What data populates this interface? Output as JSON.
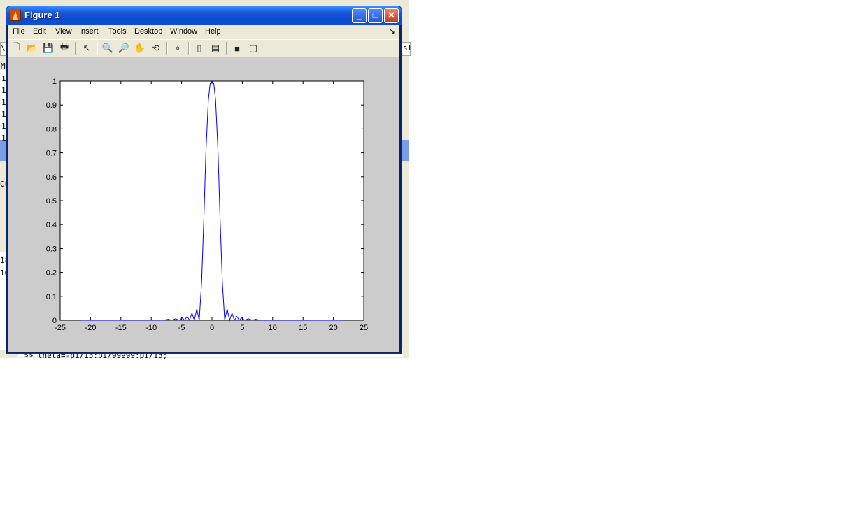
{
  "window": {
    "title": "Figure 1",
    "minimize_glyph": "_",
    "maximize_glyph": "□",
    "close_glyph": "✕"
  },
  "menubar": {
    "items": [
      "File",
      "Edit",
      "View",
      "Insert",
      "Tools",
      "Desktop",
      "Window",
      "Help"
    ],
    "dock_arrow": "↘"
  },
  "toolbar": {
    "buttons": [
      {
        "name": "new-figure-icon",
        "glyph": "🗋"
      },
      {
        "name": "open-file-icon",
        "glyph": "📂"
      },
      {
        "name": "save-figure-icon",
        "glyph": "💾"
      },
      {
        "name": "print-figure-icon",
        "glyph": "🖶"
      },
      {
        "name": "edit-plot-icon",
        "glyph": "↖"
      },
      {
        "name": "zoom-in-icon",
        "glyph": "🔍"
      },
      {
        "name": "zoom-out-icon",
        "glyph": "🔎"
      },
      {
        "name": "pan-icon",
        "glyph": "✋"
      },
      {
        "name": "rotate-3d-icon",
        "glyph": "⟲"
      },
      {
        "name": "data-cursor-icon",
        "glyph": "⌖"
      },
      {
        "name": "insert-colorbar-icon",
        "glyph": "▯"
      },
      {
        "name": "insert-legend-icon",
        "glyph": "▤"
      },
      {
        "name": "hide-plot-tools-icon",
        "glyph": "■"
      },
      {
        "name": "show-plot-tools-icon",
        "glyph": "▢"
      }
    ]
  },
  "background": {
    "command_line": ">> theta=-pi/15:pi/99999:pi/15;",
    "left_fragments": [
      "\\s",
      "M",
      "1",
      "1",
      "1",
      "1",
      "1",
      "1",
      "Cu",
      "18",
      "16"
    ],
    "right_fragments": [
      "sl"
    ]
  },
  "chart_data": {
    "type": "line",
    "title": "",
    "xlabel": "",
    "ylabel": "",
    "xlim": [
      -25,
      25
    ],
    "ylim": [
      0,
      1
    ],
    "xticks": [
      -25,
      -20,
      -15,
      -10,
      -5,
      0,
      5,
      10,
      15,
      20,
      25
    ],
    "yticks": [
      0,
      0.1,
      0.2,
      0.3,
      0.4,
      0.5,
      0.6,
      0.7,
      0.8,
      0.9,
      1
    ],
    "grid": false,
    "line_color": "#0000ff",
    "series": [
      {
        "x": [
          -21.5,
          -15,
          -10,
          -8,
          -7.2,
          -6.6,
          -6,
          -5.4,
          -4.9,
          -4.5,
          -4.1,
          -3.7,
          -3.3,
          -2.9,
          -2.5,
          -2.1,
          -1.7,
          -1.3,
          -1.0,
          -0.6,
          -0.3,
          0,
          0.3,
          0.6,
          1.0,
          1.3,
          1.7,
          2.1,
          2.5,
          2.9,
          3.3,
          3.7,
          4.1,
          4.5,
          4.9,
          5.4,
          6,
          6.6,
          7.2,
          8,
          10,
          15,
          21.5
        ],
        "y": [
          0.0,
          0.0,
          0.001,
          0.0,
          0.004,
          0.0,
          0.006,
          0.0,
          0.01,
          0.0,
          0.016,
          0.0,
          0.03,
          0.0,
          0.047,
          0.0,
          0.16,
          0.45,
          0.7,
          0.92,
          0.99,
          1.0,
          0.99,
          0.92,
          0.7,
          0.45,
          0.16,
          0.0,
          0.047,
          0.0,
          0.03,
          0.0,
          0.016,
          0.0,
          0.01,
          0.0,
          0.006,
          0.0,
          0.004,
          0.0,
          0.001,
          0.0,
          0.0
        ]
      }
    ]
  }
}
